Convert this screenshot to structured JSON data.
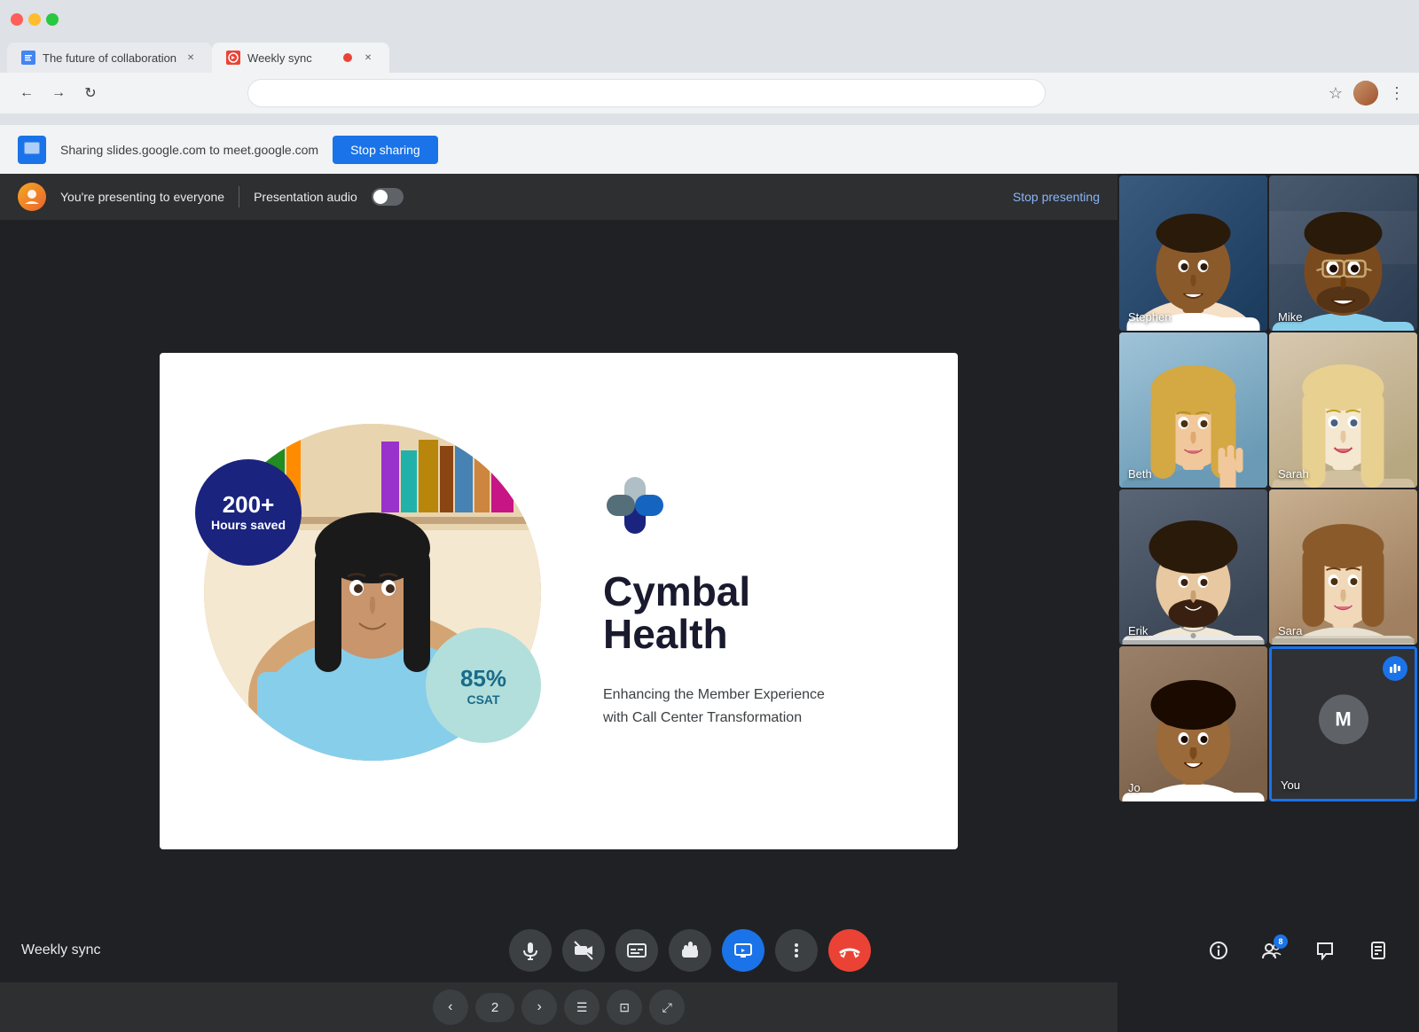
{
  "browser": {
    "tabs": [
      {
        "id": "slides-tab",
        "title": "The future of collaboration",
        "favicon_color": "#4285f4",
        "has_close": true,
        "active": false
      },
      {
        "id": "meet-tab",
        "title": "Weekly sync",
        "favicon_color": "#ea4335",
        "has_close": true,
        "active": true,
        "has_recording_dot": true
      }
    ],
    "address_bar_placeholder": ""
  },
  "sharing_bar": {
    "text": "Sharing slides.google.com to meet.google.com",
    "stop_sharing_label": "Stop sharing"
  },
  "presenting_bar": {
    "presenting_text": "You're presenting to everyone",
    "audio_label": "Presentation audio",
    "stop_presenting_label": "Stop presenting"
  },
  "slide": {
    "stat_200": "200+",
    "stat_200_label": "Hours saved",
    "brand_name_line1": "Cymbal",
    "brand_name_line2": "Health",
    "tagline_line1": "Enhancing the Member Experience",
    "tagline_line2": "with Call Center Transformation",
    "stat_85": "85%",
    "stat_85_label": "CSAT",
    "page_number": "2"
  },
  "participants": [
    {
      "id": "stephen",
      "name": "Stephen",
      "row": 1,
      "col": 1,
      "has_avatar": false,
      "bg_class": "bg-stephen"
    },
    {
      "id": "mike",
      "name": "Mike",
      "row": 1,
      "col": 2,
      "has_avatar": false,
      "bg_class": "bg-mike"
    },
    {
      "id": "beth",
      "name": "Beth",
      "row": 2,
      "col": 1,
      "has_avatar": false,
      "bg_class": "bg-beth"
    },
    {
      "id": "sarah",
      "name": "Sarah",
      "row": 2,
      "col": 2,
      "has_avatar": false,
      "bg_class": "bg-sarah"
    },
    {
      "id": "erik",
      "name": "Erik",
      "row": 3,
      "col": 1,
      "has_avatar": false,
      "bg_class": "bg-erik"
    },
    {
      "id": "sara",
      "name": "Sara",
      "row": 3,
      "col": 2,
      "has_avatar": false,
      "bg_class": "bg-sara"
    },
    {
      "id": "jo",
      "name": "Jo",
      "row": 4,
      "col": 1,
      "has_avatar": false,
      "bg_class": "bg-jo"
    },
    {
      "id": "you",
      "name": "You",
      "row": 4,
      "col": 2,
      "has_avatar": true,
      "avatar_letter": "M",
      "bg_class": "bg-you",
      "is_self": true,
      "is_speaking": true
    }
  ],
  "bottom_bar": {
    "meeting_name": "Weekly sync",
    "controls": [
      {
        "id": "mic",
        "icon": "🎤",
        "label": "Microphone",
        "variant": "normal"
      },
      {
        "id": "camera",
        "icon": "📷",
        "label": "Camera off",
        "variant": "normal"
      },
      {
        "id": "captions",
        "icon": "CC",
        "label": "Captions",
        "variant": "normal"
      },
      {
        "id": "hand",
        "icon": "✋",
        "label": "Raise hand",
        "variant": "normal"
      },
      {
        "id": "present",
        "icon": "⬡",
        "label": "Present",
        "variant": "blue"
      },
      {
        "id": "more",
        "icon": "⋮",
        "label": "More options",
        "variant": "normal"
      },
      {
        "id": "hangup",
        "icon": "📵",
        "label": "Leave call",
        "variant": "red"
      }
    ],
    "right_controls": [
      {
        "id": "info",
        "icon": "ℹ",
        "label": "Info"
      },
      {
        "id": "people",
        "icon": "👥",
        "label": "People",
        "badge": "8"
      },
      {
        "id": "chat",
        "icon": "💬",
        "label": "Chat"
      },
      {
        "id": "activities",
        "icon": "⚙",
        "label": "Activities"
      }
    ]
  },
  "colors": {
    "accent_blue": "#1a73e8",
    "background_dark": "#202124",
    "tile_border_you": "#1a73e8"
  }
}
